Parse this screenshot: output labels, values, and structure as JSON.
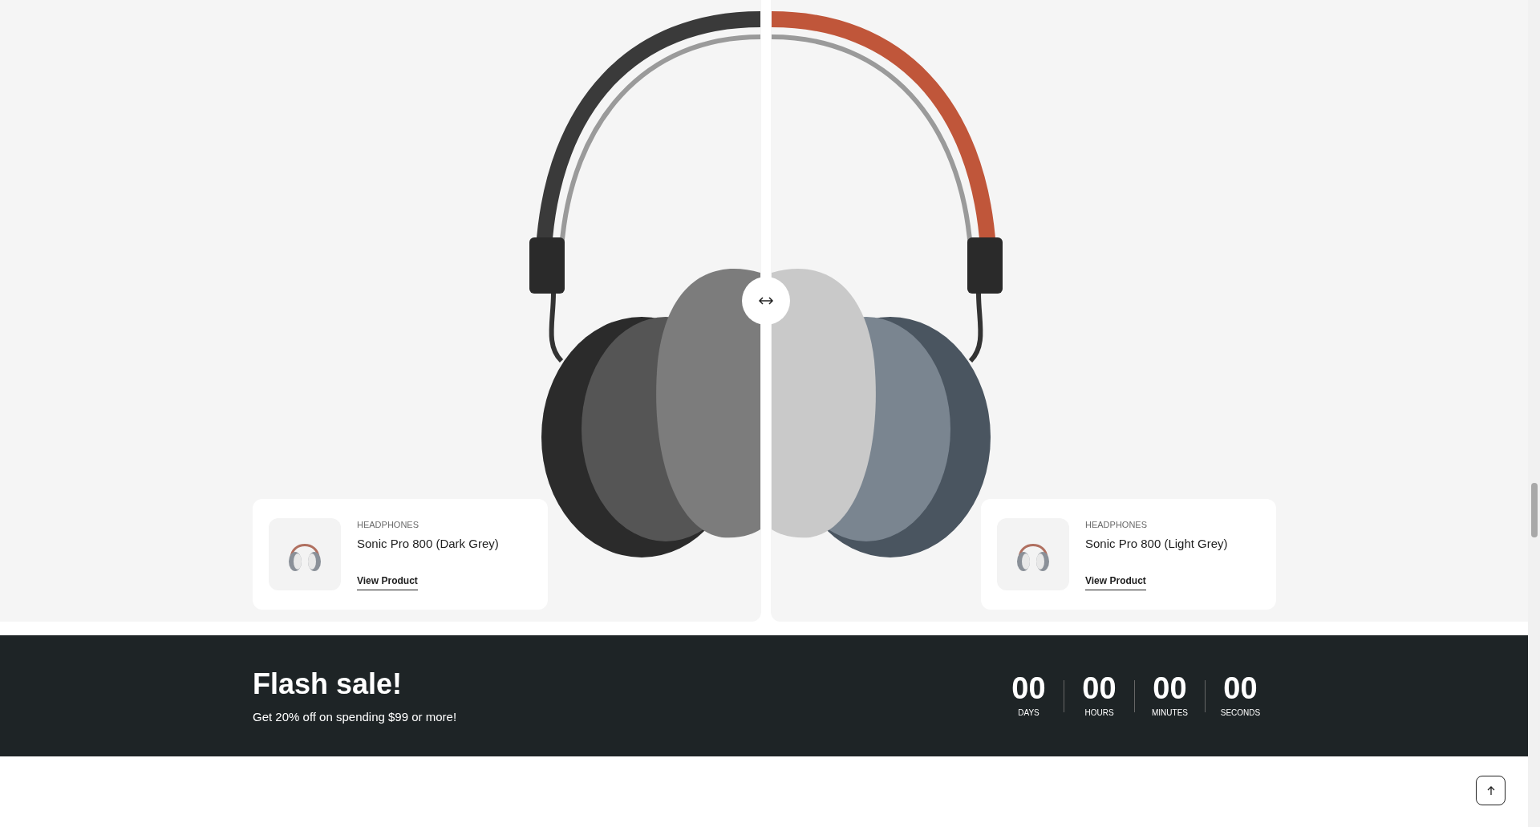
{
  "compare": {
    "products": [
      {
        "category": "HEADPHONES",
        "name": "Sonic Pro 800 (Dark Grey)",
        "link": "View Product",
        "kind": "dark"
      },
      {
        "category": "HEADPHONES",
        "name": "Sonic Pro 800 (Light Grey)",
        "link": "View Product",
        "kind": "light"
      }
    ]
  },
  "flash_sale": {
    "title": "Flash sale!",
    "subtitle": "Get 20% off on spending $99 or more!",
    "countdown": [
      {
        "value": "00",
        "label": "DAYS"
      },
      {
        "value": "00",
        "label": "HOURS"
      },
      {
        "value": "00",
        "label": "MINUTES"
      },
      {
        "value": "00",
        "label": "SECONDS"
      }
    ]
  }
}
